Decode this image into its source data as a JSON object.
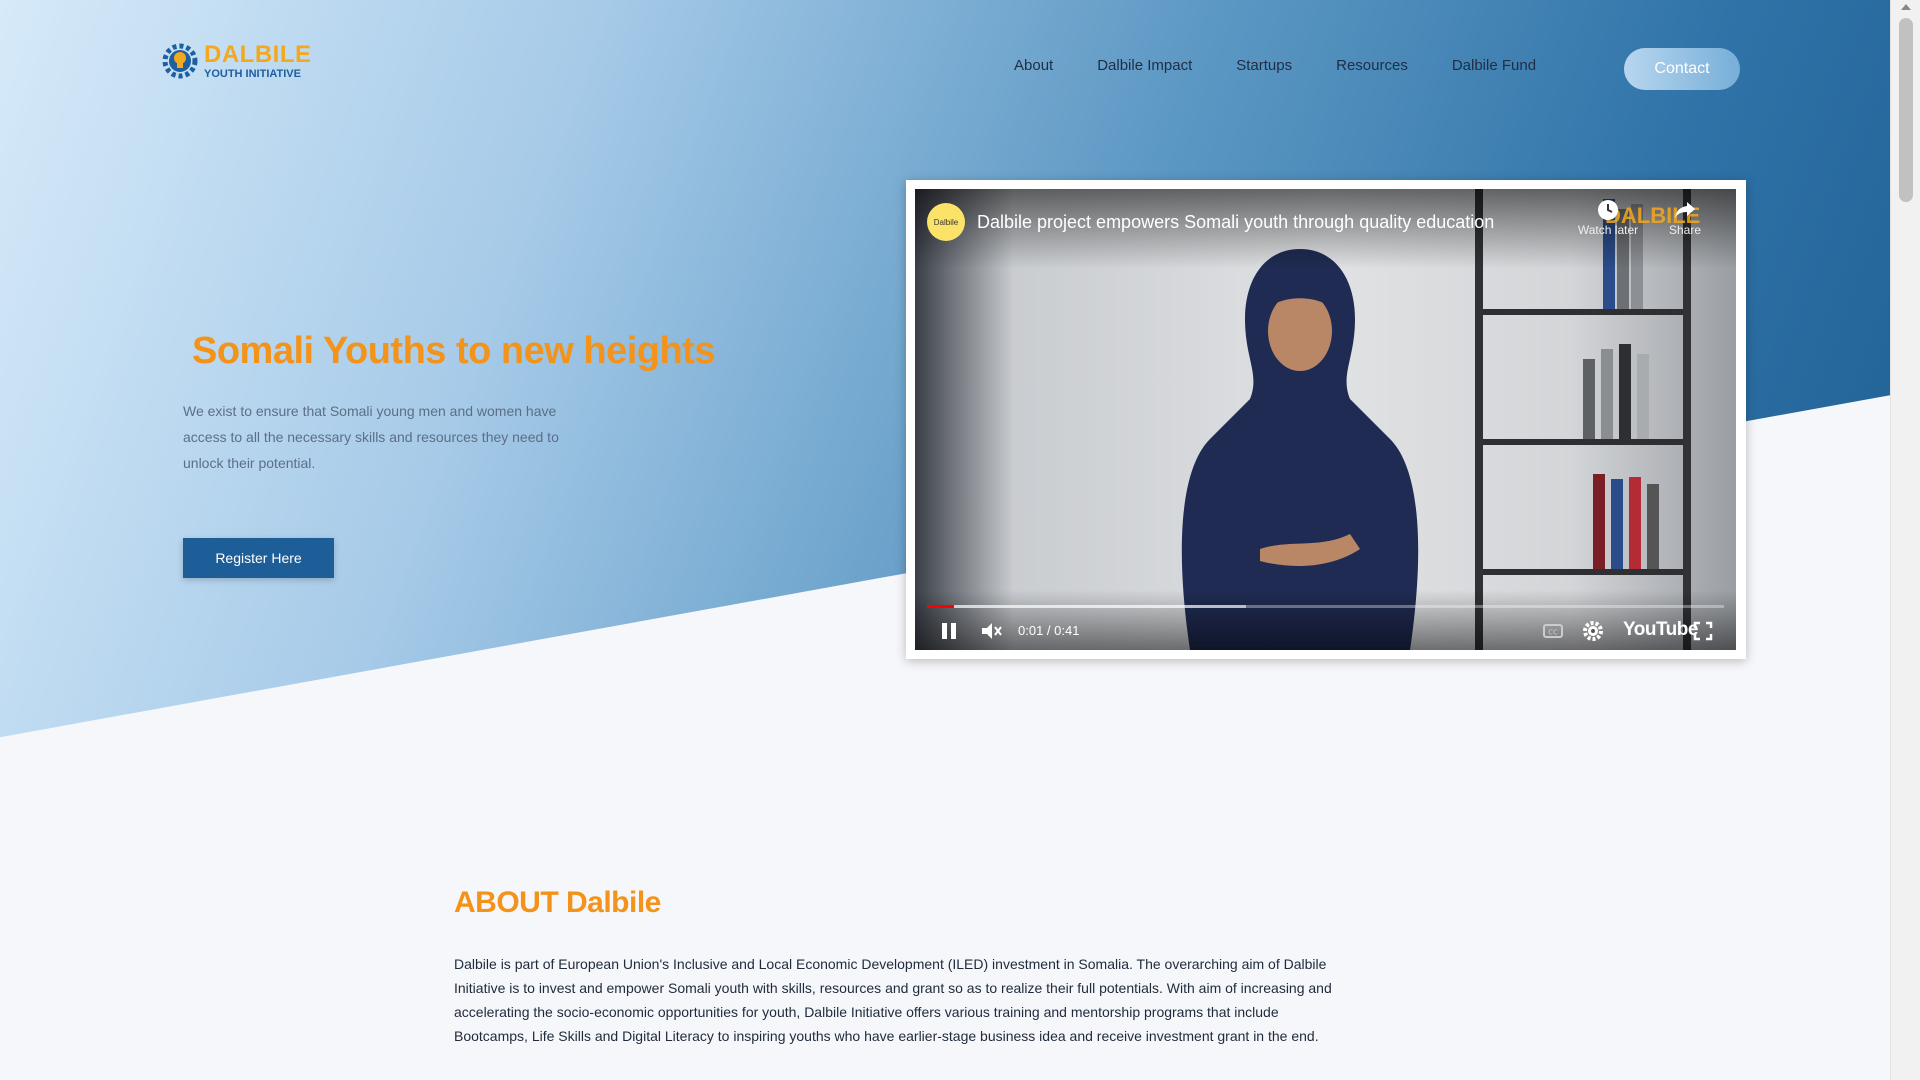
{
  "logo": {
    "title": "DALBILE",
    "subtitle": "YOUTH INITIATIVE"
  },
  "nav": {
    "items": [
      "About",
      "Dalbile Impact",
      "Startups",
      "Resources",
      "Dalbile Fund"
    ],
    "contact": "Contact"
  },
  "hero": {
    "title": "Somali Youths to new heights",
    "text": "We exist to ensure that Somali young men and women have access to all the necessary skills and resources they need to unlock their potential.",
    "register": "Register Here"
  },
  "video": {
    "channel": "Dalbile",
    "title": "Dalbile project empowers Somali youth through quality education",
    "watch_later": "Watch later",
    "share": "Share",
    "watermark": "DALBILE",
    "time": "0:01 / 0:41",
    "youtube": "YouTube",
    "played_fraction": 0.034,
    "loaded_fraction": 0.4
  },
  "about": {
    "title": "ABOUT Dalbile",
    "text": "Dalbile is part of European Union's Inclusive and Local Economic Development (ILED) investment in Somalia. The overarching aim of Dalbile Initiative is to invest and empower Somali youth with skills, resources and grant so as to realize their full potentials. With aim of increasing and accelerating the socio-economic opportunities for youth, Dalbile Initiative offers various training and mentorship programs that include Bootcamps, Life Skills and Digital Literacy to inspiring youths who have earlier-stage business idea and receive investment grant in the end."
  },
  "colors": {
    "accent": "#f39319",
    "primary": "#1d5d98",
    "youtube_red": "#ff0000"
  }
}
